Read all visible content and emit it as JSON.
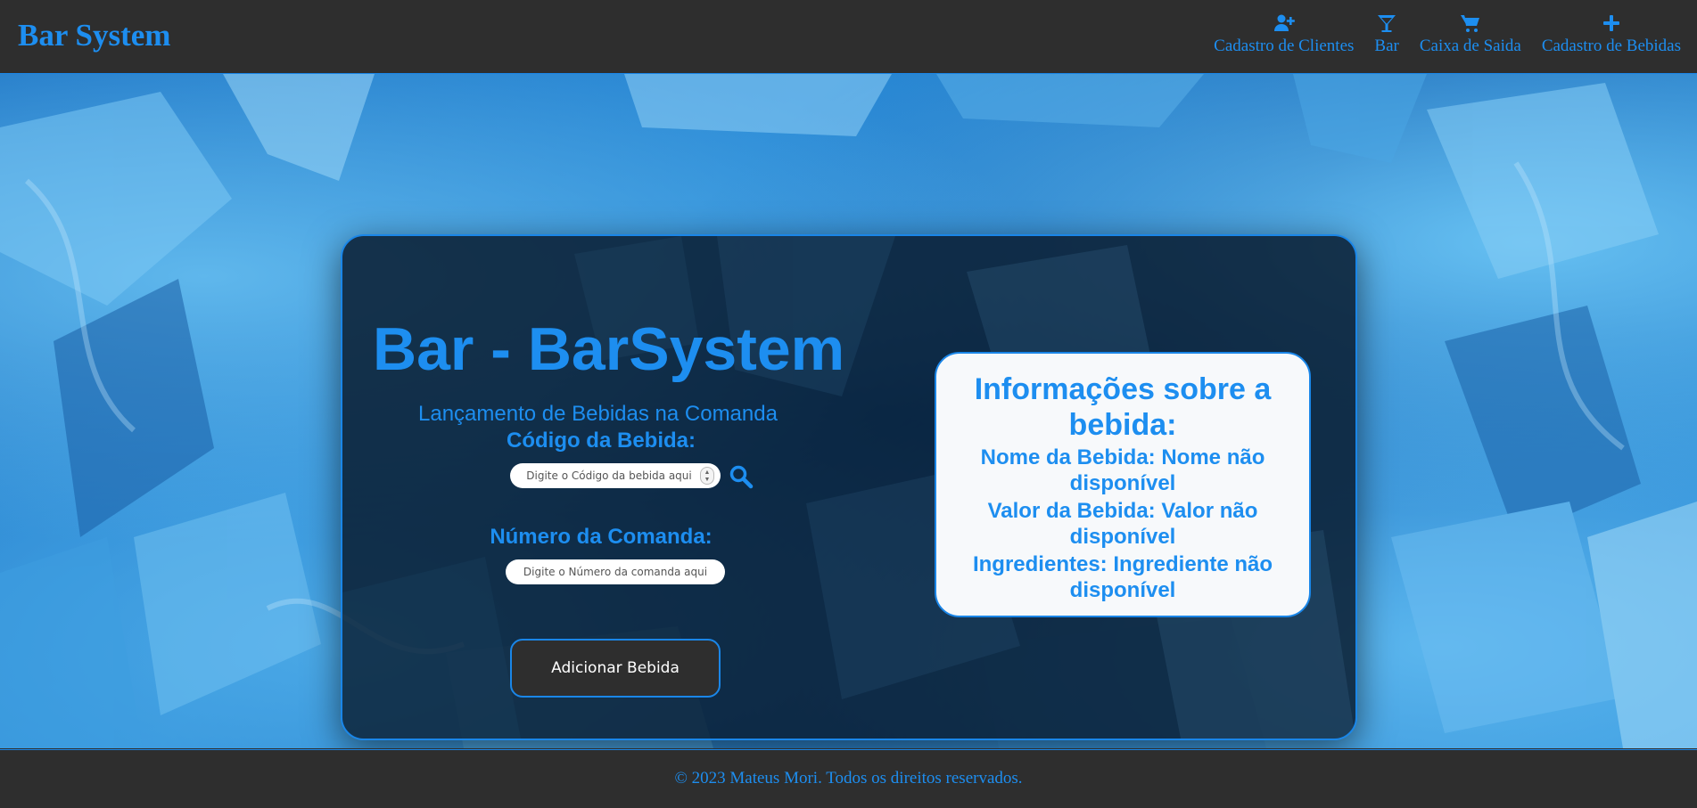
{
  "header": {
    "brand": "Bar System",
    "nav": [
      {
        "label": "Cadastro de Clientes",
        "icon": "user-plus-icon"
      },
      {
        "label": "Bar",
        "icon": "cocktail-glass-icon"
      },
      {
        "label": "Caixa de Saida",
        "icon": "shopping-cart-icon"
      },
      {
        "label": "Cadastro de Bebidas",
        "icon": "plus-icon"
      }
    ]
  },
  "main": {
    "title": "Bar - BarSystem",
    "subtitle": "Lançamento de Bebidas na Comanda",
    "code_label": "Código da Bebida:",
    "code_placeholder": "Digite o Código da bebida aqui",
    "comanda_label": "Número da Comanda:",
    "comanda_placeholder": "Digite o Número da comanda aqui",
    "add_button": "Adicionar Bebida"
  },
  "info": {
    "title": "Informações sobre a bebida:",
    "name_line": "Nome da Bebida: Nome não disponível",
    "value_line": "Valor da Bebida: Valor não disponível",
    "ingredients_line": "Ingredientes: Ingrediente não disponível"
  },
  "footer": {
    "text": "© 2023 Mateus Mori. Todos os direitos reservados."
  },
  "colors": {
    "accent": "#1d8ef0",
    "header_bg": "#2e2e2e",
    "card_bg": "#061628",
    "info_bg": "#f7f9fb",
    "button_bg": "#2e2e2e"
  }
}
